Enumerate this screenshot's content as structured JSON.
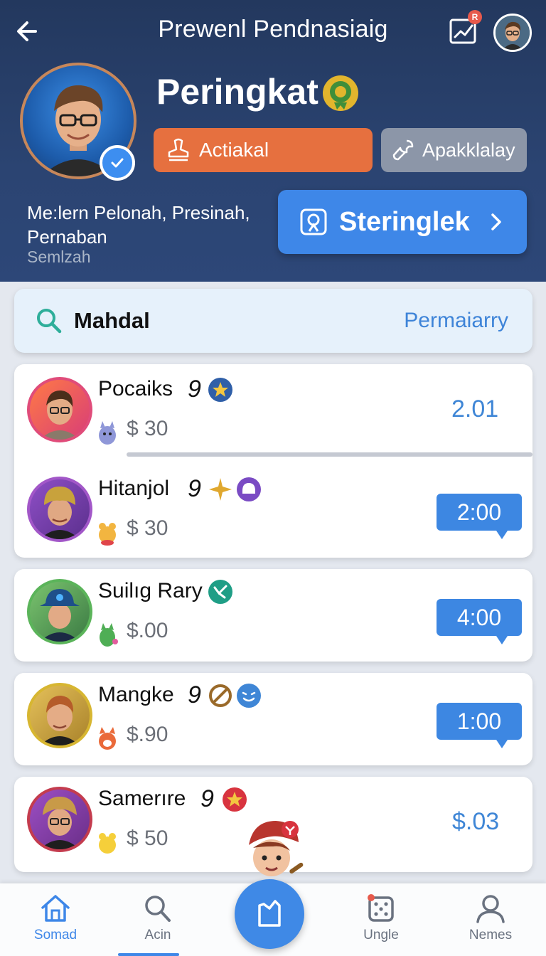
{
  "header": {
    "title": "Prewenl Pendnasiaig",
    "notification_count": "R",
    "rank_title": "Peringkat",
    "buttons": {
      "active_label": "Actiakal",
      "apply_label": "Apakklalay"
    },
    "description": "Me:lern Pelonah, Presinah, Pernaban",
    "description_sub": "Semlzah",
    "cta_label": "Steringlek"
  },
  "search": {
    "query": "Mahdal",
    "filter_label": "Permaiarry"
  },
  "players": [
    {
      "name": "Pocaiks",
      "number": "9",
      "money": "$ 30",
      "value": "2.01",
      "value_style": "plain",
      "ring": "#e04c7a"
    },
    {
      "name": "Hitanjol",
      "number": "9",
      "money": "$ 30",
      "value": "2:00",
      "value_style": "bubble",
      "ring": "#a257c8"
    },
    {
      "name": "Suilıg Rary",
      "number": "",
      "money": "$.00",
      "value": "4:00",
      "value_style": "bubble",
      "ring": "#5bb45a"
    },
    {
      "name": "Mangke",
      "number": "9",
      "money": "$.90",
      "value": "1:00",
      "value_style": "bubble",
      "ring": "#d7b631"
    },
    {
      "name": "Samerıre",
      "number": "9",
      "money": "$ 50",
      "value": "$.03",
      "value_style": "plain",
      "ring": "#c43c4e"
    }
  ],
  "bottom_nav": [
    {
      "label": "Somad",
      "icon": "home-icon",
      "active": true
    },
    {
      "label": "Acin",
      "icon": "search-icon",
      "active": false
    },
    {
      "label": "Ungle",
      "icon": "dice-icon",
      "active": false
    },
    {
      "label": "Nemes",
      "icon": "user-icon",
      "active": false
    }
  ],
  "colors": {
    "header_bg": "#2b4472",
    "accent_blue": "#3e87e8",
    "orange": "#e6703f",
    "gray_button": "#8c96a8"
  }
}
